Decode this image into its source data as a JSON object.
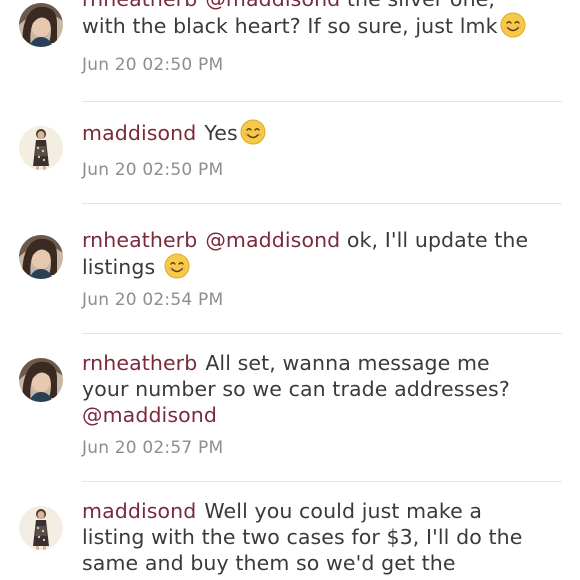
{
  "comments": [
    {
      "username": "rnheatherb",
      "mention": "@maddisond",
      "line1_after": " the silver one,",
      "line2": "with the black heart? If so sure, just lmk",
      "emoji": "smiling-face-emoji",
      "timestamp": "Jun 20 02:50 PM"
    },
    {
      "username": "maddisond",
      "body": "Yes",
      "emoji": "smiling-face-emoji",
      "timestamp": "Jun 20 02:50 PM"
    },
    {
      "username": "rnheatherb",
      "mention": "@maddisond",
      "line1_after": " ok, I'll update the",
      "line2": "listings ",
      "emoji": "smiling-face-emoji",
      "timestamp": "Jun 20 02:54 PM"
    },
    {
      "username": "rnheatherb",
      "line1_after": "All set, wanna message me",
      "line2": "your number so we can trade addresses?",
      "mention": "@maddisond",
      "timestamp": "Jun 20 02:57 PM"
    },
    {
      "username": "maddisond",
      "line1_after": "Well you could just make a",
      "line2": "listing with the two cases for $3, I'll do the",
      "line3": "same and buy them so we'd get the"
    }
  ],
  "colors": {
    "username": "#7b2a3b",
    "text": "#3a3a3a",
    "timestamp": "#8e8e8e",
    "divider": "#e4e4e4"
  }
}
